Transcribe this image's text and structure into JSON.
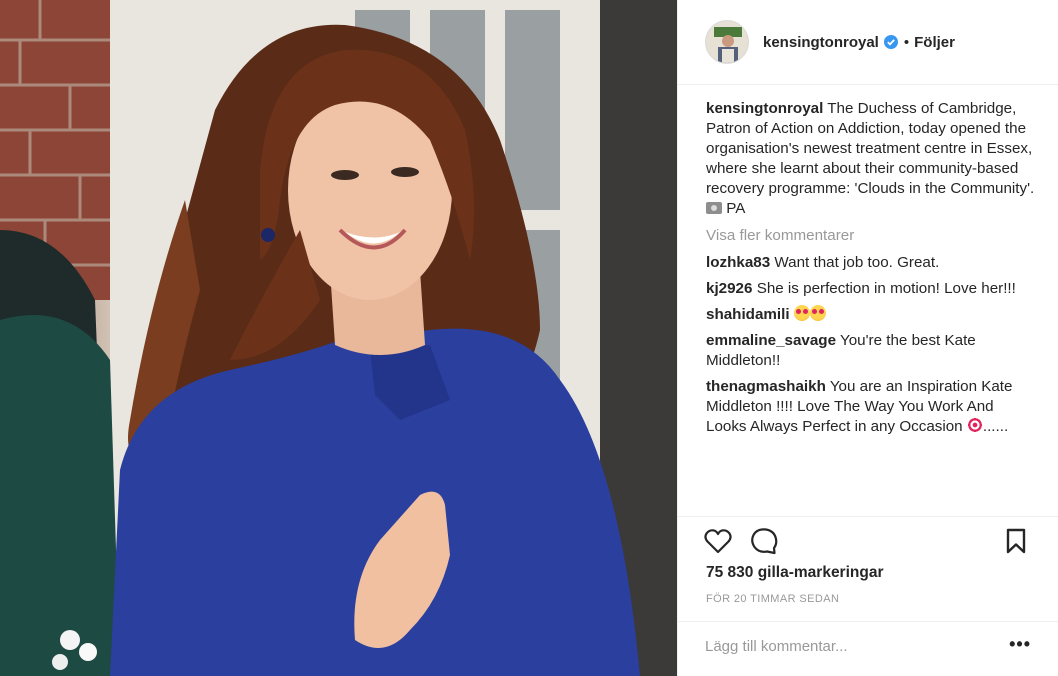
{
  "post": {
    "username": "kensingtonroyal",
    "follow_status": "Följer",
    "caption": "The Duchess of Cambridge, Patron of Action on Addiction, today opened the organisation's newest treatment centre in Essex, where she learnt about their community-based recovery programme: 'Clouds in the Community'.",
    "caption_credit": "PA",
    "view_more_comments": "Visa fler kommentarer",
    "comments": [
      {
        "user": "lozhka83",
        "text": "Want that job too. Great."
      },
      {
        "user": "kj2926",
        "text": "She is perfection in motion! Love her!!!"
      },
      {
        "user": "shahidamili",
        "text": ""
      },
      {
        "user": "emmaline_savage",
        "text": "You're the best Kate Middleton!!"
      },
      {
        "user": "thenagmashaikh",
        "text": "You are an Inspiration Kate Middleton !!!! Love The Way You Work And Looks Always Perfect in any Occasion",
        "tail": "......"
      }
    ],
    "likes": "75 830 gilla-markeringar",
    "timestamp": "FÖR 20 TIMMAR SEDAN",
    "add_comment_placeholder": "Lägg till kommentar...",
    "options": "•••"
  },
  "icons": {
    "verified": "verified-badge-icon",
    "like": "heart-icon",
    "comment": "comment-bubble-icon",
    "save": "bookmark-icon"
  },
  "colors": {
    "verified_blue": "#3897f0",
    "coat_blue": "#2a3f9e",
    "muted_text": "#999999"
  }
}
